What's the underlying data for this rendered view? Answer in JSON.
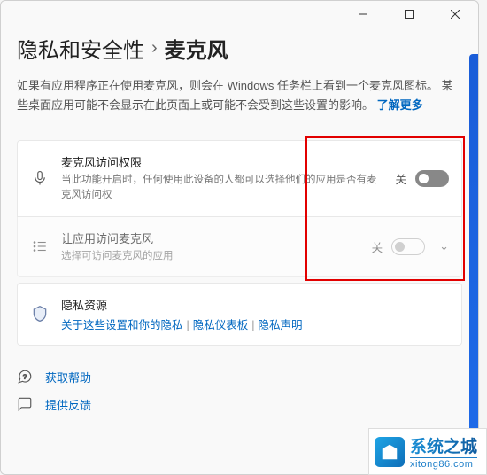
{
  "header": {
    "parent": "隐私和安全性",
    "current": "麦克风"
  },
  "info": {
    "text": "如果有应用程序正在使用麦克风，则会在 Windows 任务栏上看到一个麦克风图标。 某些桌面应用可能不会显示在此页面上或可能不会受到这些设置的影响。 ",
    "learn_more": "了解更多"
  },
  "cards": {
    "mic_access": {
      "title": "麦克风访问权限",
      "sub": "当此功能开启时，任何使用此设备的人都可以选择他们的应用是否有麦克风访问权",
      "state": "关"
    },
    "app_access": {
      "title": "让应用访问麦克风",
      "sub": "选择可访问麦克风的应用",
      "state": "关"
    },
    "privacy": {
      "title": "隐私资源",
      "link1": "关于这些设置和你的隐私",
      "link2": "隐私仪表板",
      "link3": "隐私声明"
    }
  },
  "footer": {
    "help": "获取帮助",
    "feedback": "提供反馈"
  },
  "watermark": {
    "name": "系统之城",
    "url": "xitong86.com"
  }
}
